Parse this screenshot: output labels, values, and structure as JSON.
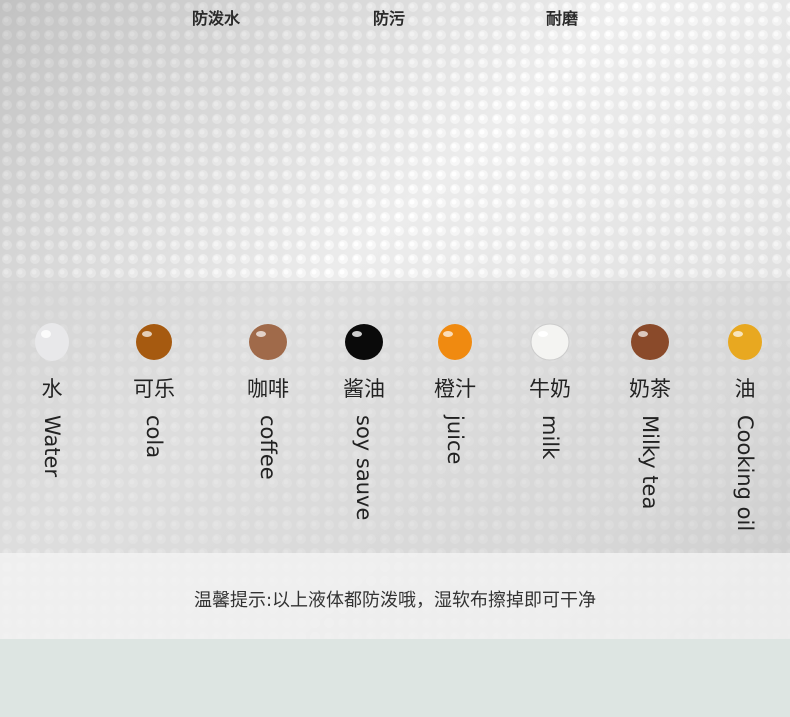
{
  "top_labels": [
    "防泼水",
    "防污",
    "耐磨"
  ],
  "liquids": [
    {
      "zh": "水",
      "en": "Water",
      "icon": "water-drop-icon",
      "color": "#e8e8ea"
    },
    {
      "zh": "可乐",
      "en": "cola",
      "icon": "cola-drop-icon",
      "color": "#a65a10"
    },
    {
      "zh": "咖啡",
      "en": "coffee",
      "icon": "coffee-drop-icon",
      "color": "#a06a4a"
    },
    {
      "zh": "酱油",
      "en": "soy sauve",
      "icon": "soy-sauce-drop-icon",
      "color": "#0a0a0a"
    },
    {
      "zh": "橙汁",
      "en": "juice",
      "icon": "juice-drop-icon",
      "color": "#f08a10"
    },
    {
      "zh": "牛奶",
      "en": "milk",
      "icon": "milk-drop-icon",
      "color": "#f4f4f2"
    },
    {
      "zh": "奶茶",
      "en": "Milky tea",
      "icon": "milk-tea-drop-icon",
      "color": "#8a4a2a"
    },
    {
      "zh": "油",
      "en": "Cooking oil",
      "icon": "oil-drop-icon",
      "color": "#e8a820"
    }
  ],
  "tip": "温馨提示:以上液体都防泼哦，湿软布擦掉即可干净"
}
